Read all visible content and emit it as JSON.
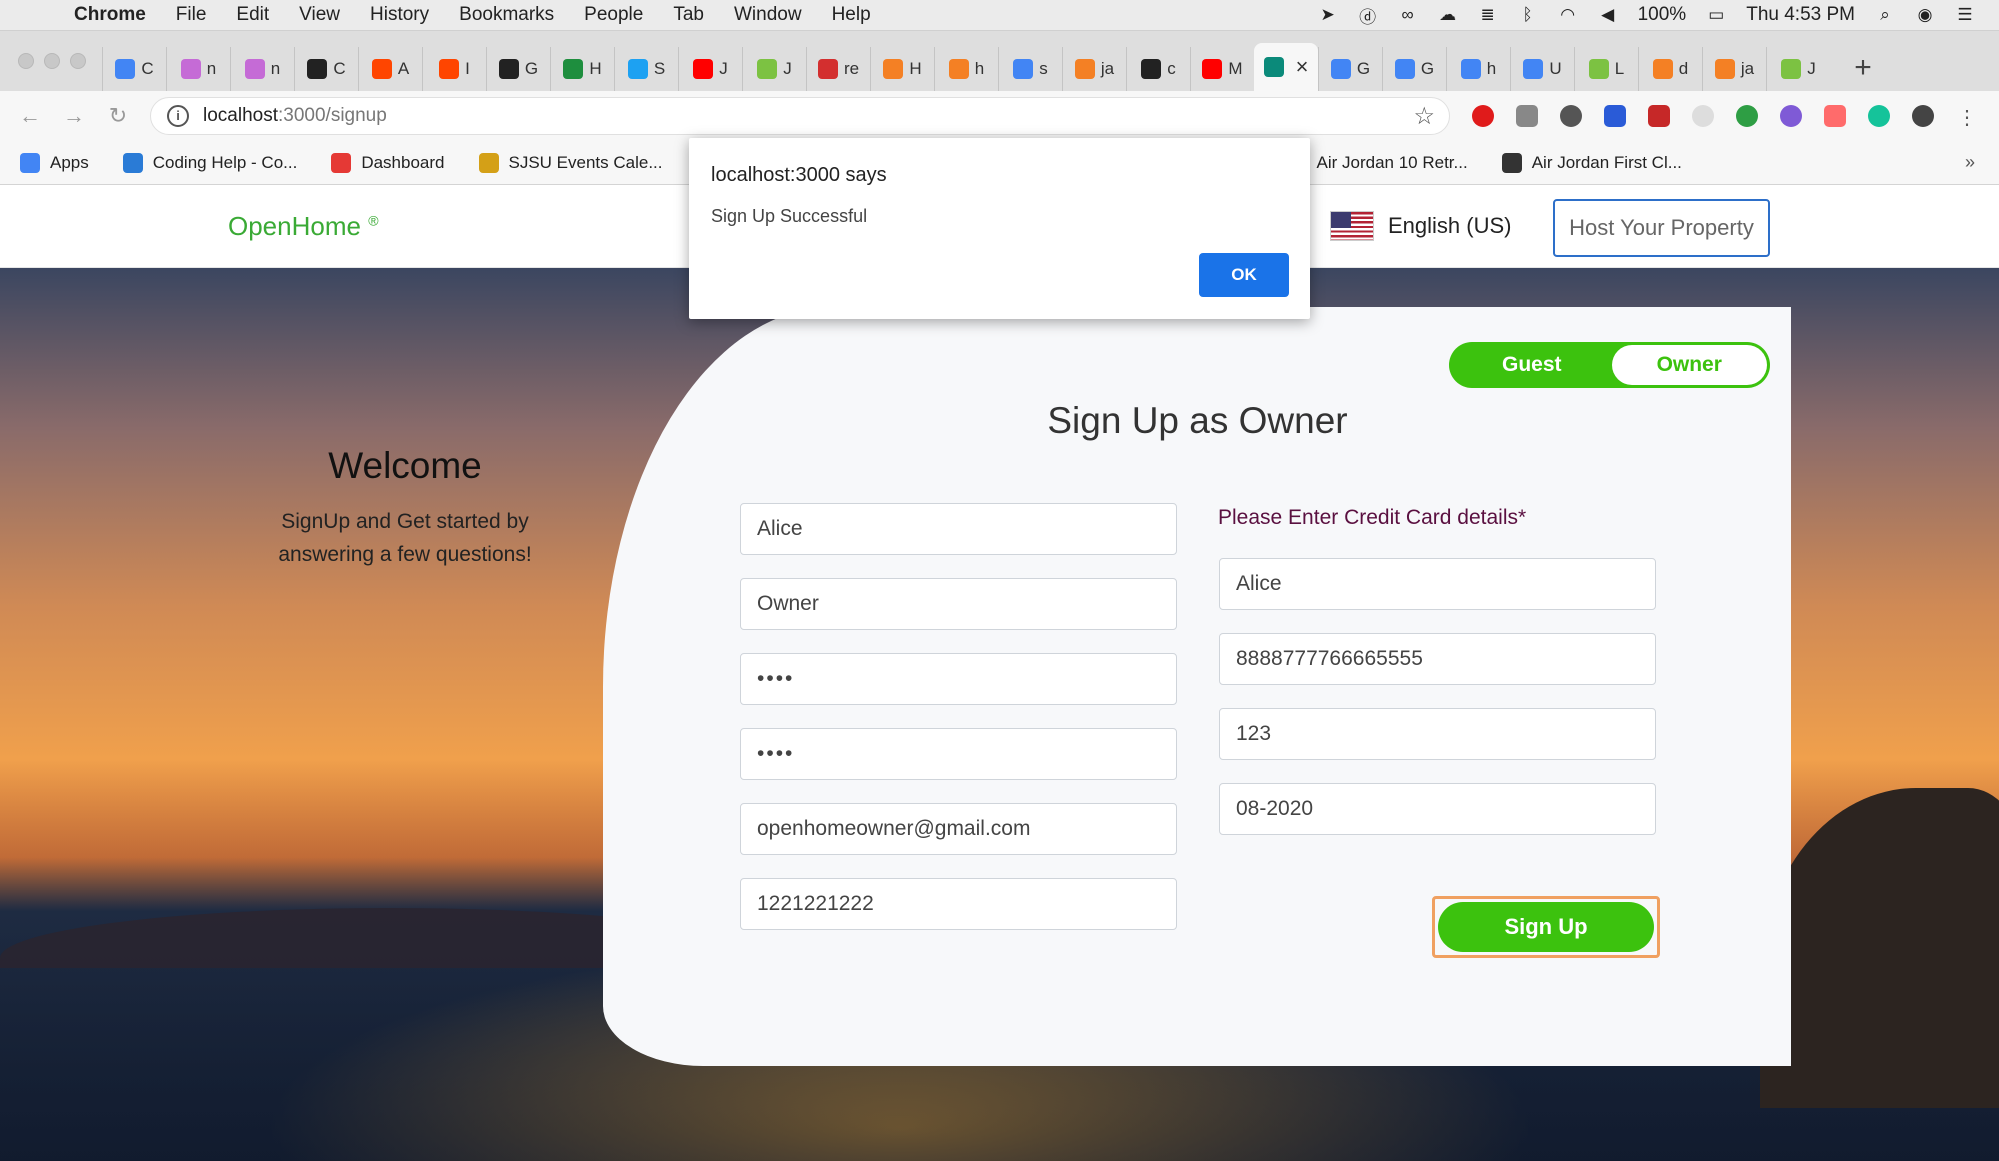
{
  "menubar": {
    "app": "Chrome",
    "items": [
      "File",
      "Edit",
      "View",
      "History",
      "Bookmarks",
      "People",
      "Tab",
      "Window",
      "Help"
    ],
    "battery": "100%",
    "clock": "Thu 4:53 PM"
  },
  "tabs": [
    {
      "letter": "C",
      "color": "#4285f4"
    },
    {
      "letter": "n",
      "color": "#c56bd6"
    },
    {
      "letter": "n",
      "color": "#c56bd6"
    },
    {
      "letter": "C",
      "color": "#222222"
    },
    {
      "letter": "A",
      "color": "#ff4500"
    },
    {
      "letter": "I",
      "color": "#ff4500"
    },
    {
      "letter": "G",
      "color": "#222222"
    },
    {
      "letter": "H",
      "color": "#1e8e3e"
    },
    {
      "letter": "S",
      "color": "#1da1f2"
    },
    {
      "letter": "J",
      "color": "#ff0000"
    },
    {
      "letter": "J",
      "color": "#7cc242"
    },
    {
      "letter": "re",
      "color": "#d32f2f"
    },
    {
      "letter": "H",
      "color": "#f48024"
    },
    {
      "letter": "h",
      "color": "#f48024"
    },
    {
      "letter": "s",
      "color": "#4285f4"
    },
    {
      "letter": "ja",
      "color": "#f48024"
    },
    {
      "letter": "c",
      "color": "#222222"
    },
    {
      "letter": "M",
      "color": "#ff0000"
    },
    {
      "letter": "",
      "color": "#0b8a7a"
    },
    {
      "letter": "G",
      "color": "#4285f4"
    },
    {
      "letter": "G",
      "color": "#4285f4"
    },
    {
      "letter": "h",
      "color": "#4285f4"
    },
    {
      "letter": "U",
      "color": "#4285f4"
    },
    {
      "letter": "L",
      "color": "#7cc242"
    },
    {
      "letter": "d",
      "color": "#f48024"
    },
    {
      "letter": "ja",
      "color": "#f48024"
    },
    {
      "letter": "J",
      "color": "#7cc242"
    }
  ],
  "address": {
    "host": "localhost",
    "path": ":3000/signup"
  },
  "bookmarks": [
    {
      "label": "Apps",
      "color": "#4285f4"
    },
    {
      "label": "Coding Help - Co...",
      "color": "#2a7bd6"
    },
    {
      "label": "Dashboard",
      "color": "#e53935"
    },
    {
      "label": "SJSU Events Cale...",
      "color": "#d4a017"
    },
    {
      "label": "Air Jordan 10 Retr...",
      "color": "#333333"
    },
    {
      "label": "Air Jordan First Cl...",
      "color": "#333333"
    }
  ],
  "site": {
    "brand": "OpenHome",
    "brand_mark": "®",
    "language": "English (US)",
    "host_button": "Host Your Property"
  },
  "welcome": {
    "title": "Welcome",
    "text": "SignUp and Get started by answering a few questions!"
  },
  "form": {
    "toggle": {
      "guest": "Guest",
      "owner": "Owner",
      "selected": "Owner"
    },
    "title": "Sign Up as Owner",
    "first_name": "Alice",
    "last_name": "Owner",
    "password": "••••",
    "confirm_password": "••••",
    "email": "openhomeowner@gmail.com",
    "phone": "1221221222",
    "cc_label": "Please Enter Credit Card details*",
    "cc_name": "Alice",
    "cc_number": "8888777766665555",
    "cc_cvv": "123",
    "cc_expiry": "08-2020",
    "submit": "Sign Up"
  },
  "dialog": {
    "title": "localhost:3000 says",
    "message": "Sign Up Successful",
    "ok": "OK"
  }
}
